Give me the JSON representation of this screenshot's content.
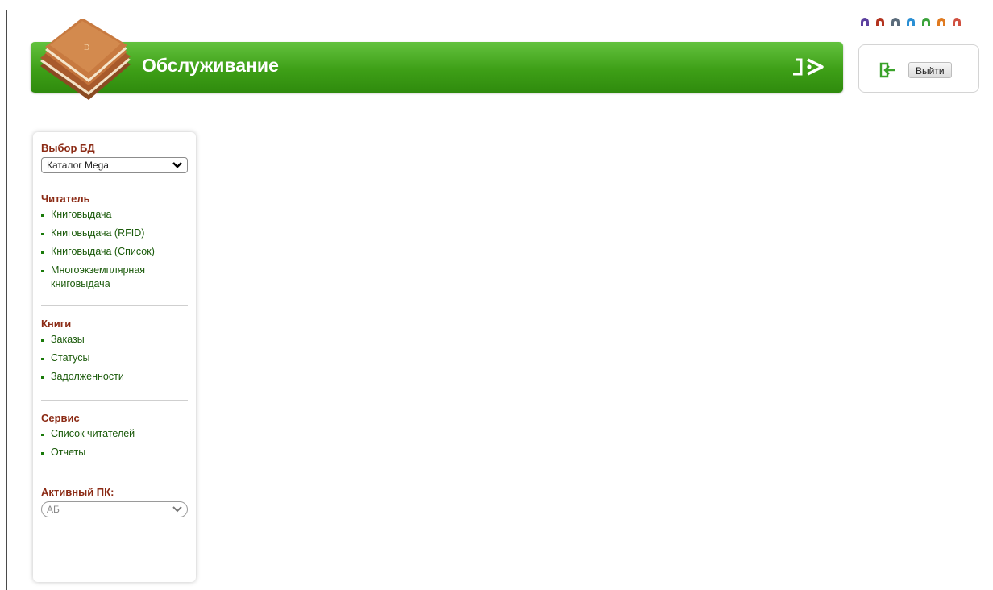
{
  "header": {
    "title": "Обслуживание",
    "logout_label": "Выйти",
    "accent_color": "#3e9f17"
  },
  "theme_swatches": [
    "#5b3f9e",
    "#b3331f",
    "#5a6b7a",
    "#2a8fd4",
    "#3aa23a",
    "#e07a1f",
    "#d05040"
  ],
  "sidebar": {
    "db_section": {
      "title": "Выбор БД",
      "select_value": "Каталог Mega"
    },
    "reader_section": {
      "title": "Читатель",
      "items": [
        "Книговыдача",
        "Книговыдача (RFID)",
        "Книговыдача (Список)",
        "Многоэкземплярная книговыдача"
      ]
    },
    "books_section": {
      "title": "Книги",
      "items": [
        "Заказы",
        "Статусы",
        "Задолженности"
      ]
    },
    "service_section": {
      "title": "Сервис",
      "items": [
        "Список читателей",
        "Отчеты"
      ]
    },
    "active_pc_section": {
      "title": "Активный ПК:",
      "select_value": "АБ"
    }
  }
}
